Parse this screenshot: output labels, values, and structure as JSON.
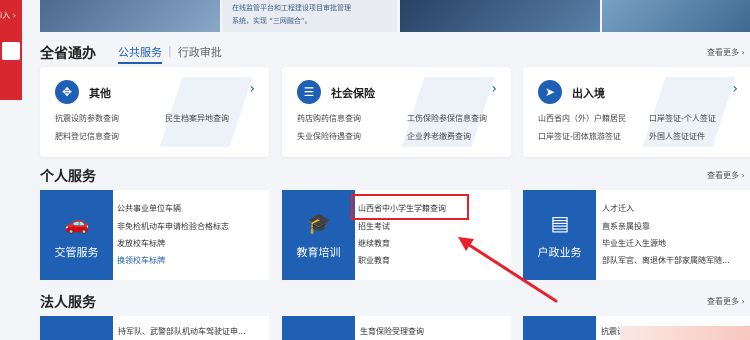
{
  "banner": {
    "notice": "i入 ›",
    "tile_b_line1": "在线监管平台和工程建设项目审批管理",
    "tile_b_line2": "系统，实现 “三网融合”。"
  },
  "province": {
    "title": "全省通办",
    "tabs": [
      "公共服务",
      "|",
      "行政审批"
    ],
    "more": "查看更多",
    "cards": [
      {
        "title": "其他",
        "links": [
          "抗震设防参数查询",
          "民生档案异地查询",
          "肥料登记信息查询"
        ]
      },
      {
        "title": "社会保险",
        "links": [
          "药店购药信息查询",
          "工伤保险参保信息查询",
          "失业保险待遇查询",
          "企业养老缴费查询"
        ]
      },
      {
        "title": "出入境",
        "links": [
          "山西省内（外）户籍居民",
          "口岸签证-个人签证",
          "口岸签证-团体旅游签证",
          "外国人签证证件"
        ]
      }
    ]
  },
  "personal": {
    "title": "个人服务",
    "more": "查看更多",
    "cards": [
      {
        "label": "交管服务",
        "links": [
          "公共事业单位车辆",
          "非免检机动车申请检验合格标志",
          "发放校车标牌",
          "换领校车标牌"
        ]
      },
      {
        "label": "教育培训",
        "links": [
          "山西省中小学生学籍查询",
          "招生考试",
          "继续教育",
          "职业教育"
        ]
      },
      {
        "label": "户政业务",
        "links": [
          "人才迁入",
          "直系亲属投靠",
          "毕业生迁入生源地",
          "部队军官、离退休干部家属随军随..."
        ]
      }
    ]
  },
  "legal": {
    "title": "法人服务",
    "more": "查看更多",
    "cards": [
      {
        "link": "持军队、武警部队机动车驾驶证申..."
      },
      {
        "link": "生育保险受理查询"
      },
      {
        "link": "抗震设防参数查询"
      }
    ]
  },
  "colors": {
    "primary": "#1f5fb4",
    "highlight": "#e8202a",
    "banner_red": "#d7282f"
  }
}
